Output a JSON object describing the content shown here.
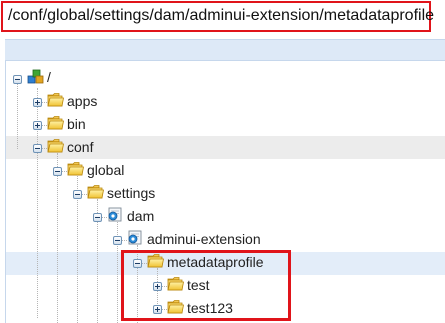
{
  "path_bar": {
    "value": "/conf/global/settings/dam/adminui-extension/metadataprofile"
  },
  "tree": {
    "root": {
      "label": "/",
      "icon": "repository-root-icon"
    },
    "apps": {
      "label": "apps",
      "icon": "folder-icon"
    },
    "bin": {
      "label": "bin",
      "icon": "folder-icon"
    },
    "conf": {
      "label": "conf",
      "icon": "folder-icon"
    },
    "global": {
      "label": "global",
      "icon": "folder-icon"
    },
    "settings": {
      "label": "settings",
      "icon": "folder-icon"
    },
    "dam": {
      "label": "dam",
      "icon": "node-icon"
    },
    "adminui_extension": {
      "label": "adminui-extension",
      "icon": "node-icon"
    },
    "metadataprofile": {
      "label": "metadataprofile",
      "icon": "folder-icon"
    },
    "test": {
      "label": "test",
      "icon": "folder-icon"
    },
    "test123": {
      "label": "test123",
      "icon": "folder-icon"
    }
  },
  "colors": {
    "highlight_red": "#e0141a",
    "selected_row": "#ececec",
    "hover_row": "#e3edf9",
    "header_band": "#dde9f7"
  }
}
